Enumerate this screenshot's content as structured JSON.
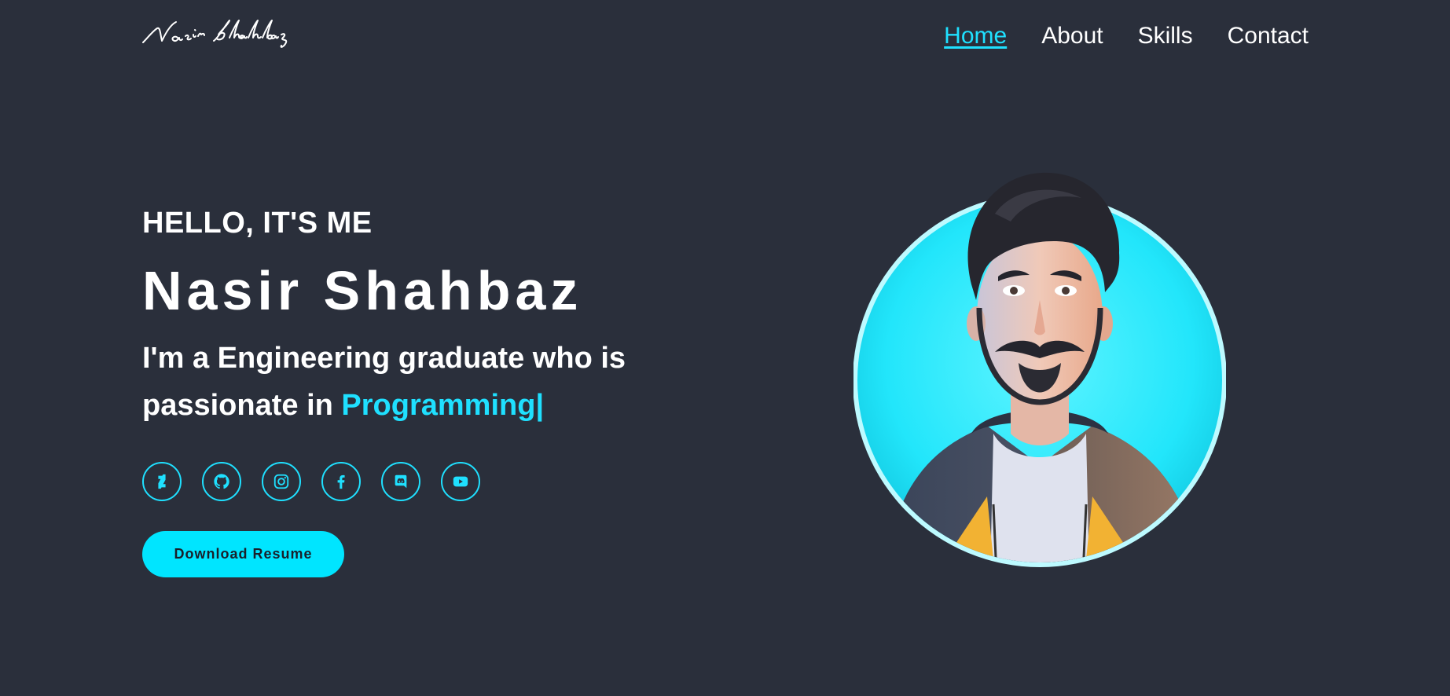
{
  "brand": {
    "logo_text": "Nasir Shahbaz"
  },
  "nav": {
    "items": [
      {
        "label": "Home",
        "active": true
      },
      {
        "label": "About",
        "active": false
      },
      {
        "label": "Skills",
        "active": false
      },
      {
        "label": "Contact",
        "active": false
      }
    ]
  },
  "hero": {
    "greeting": "HELLO, IT'S ME",
    "name": "Nasir Shahbaz",
    "tagline_prefix": "I'm a Engineering graduate who is passionate in ",
    "tagline_accent": "Programming|"
  },
  "socials": [
    {
      "icon": "deviantart-icon"
    },
    {
      "icon": "github-icon"
    },
    {
      "icon": "instagram-icon"
    },
    {
      "icon": "facebook-icon"
    },
    {
      "icon": "discord-icon"
    },
    {
      "icon": "youtube-icon"
    }
  ],
  "cta": {
    "download_label": "Download Resume"
  },
  "colors": {
    "background": "#2a2f3b",
    "accent": "#1fe0ff",
    "button": "#00e5ff",
    "text": "#ffffff"
  },
  "avatar": {
    "icon": "avatar-portrait"
  }
}
